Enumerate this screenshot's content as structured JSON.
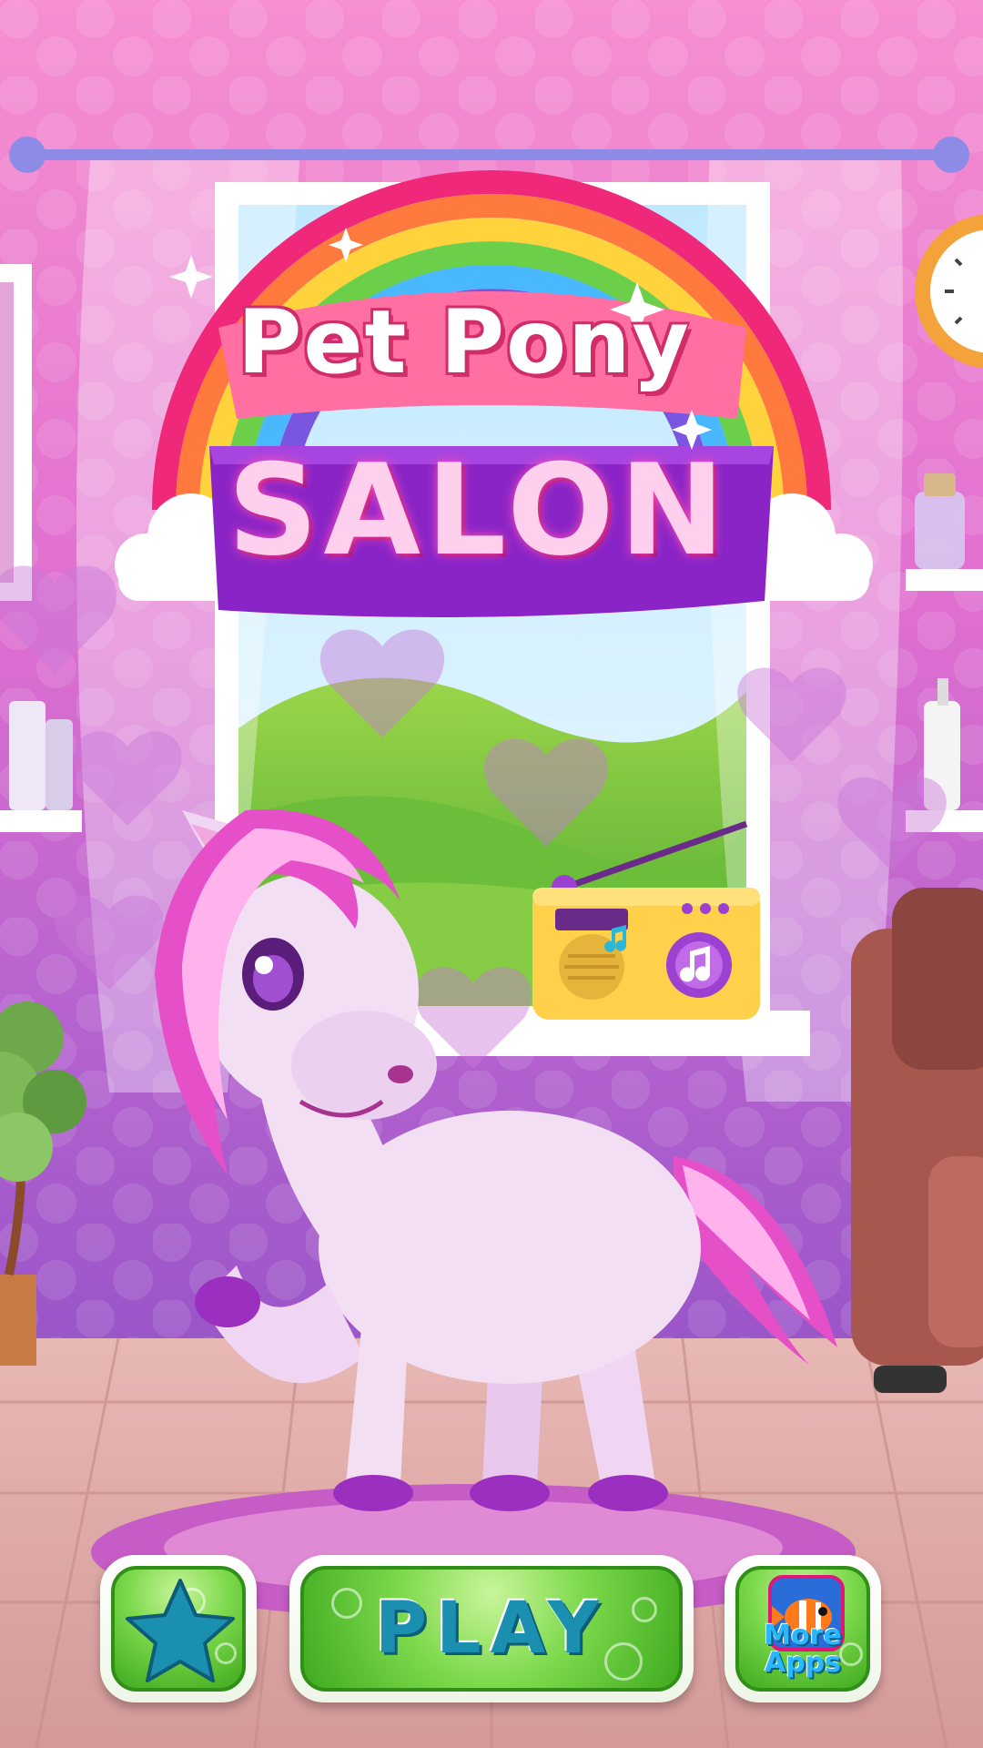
{
  "title": {
    "line1": "Pet Pony",
    "line2": "SALON"
  },
  "buttons": {
    "rate_icon": "star-icon",
    "play_label": "PLAY",
    "more_apps_label": "More Apps",
    "more_apps_icon": "clownfish-icon"
  },
  "scene": {
    "radio_icon": "music-note-icon",
    "colors": {
      "wall": "#f58fcf",
      "button_green": "#62c935",
      "play_text": "#1b8fb0",
      "banner_purple": "#8a24c6"
    }
  }
}
